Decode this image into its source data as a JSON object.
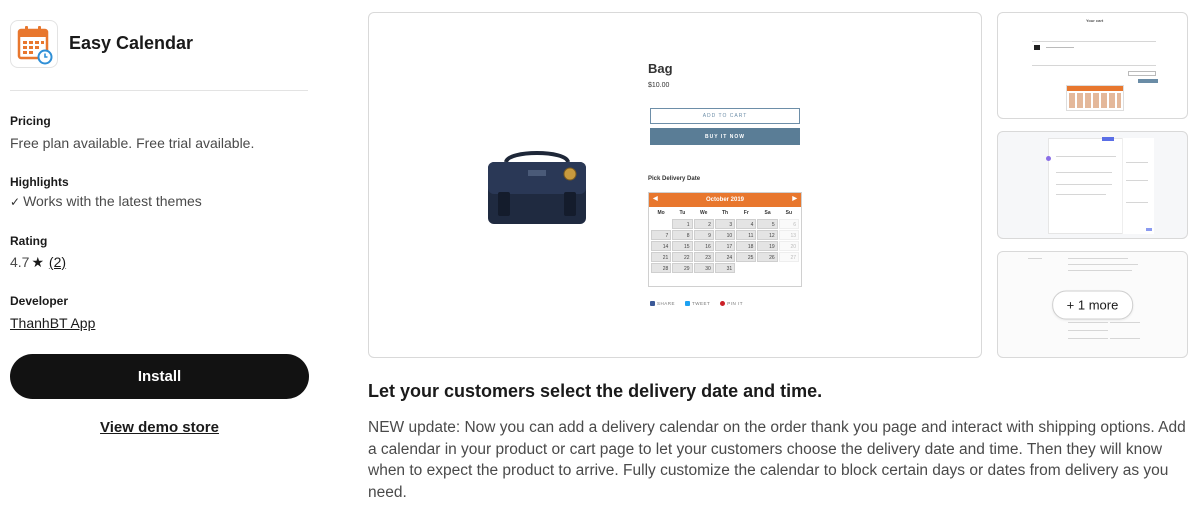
{
  "app": {
    "name": "Easy Calendar",
    "icon": "calendar-clock-icon",
    "brand_color": "#e8772e"
  },
  "details": {
    "pricing": {
      "title": "Pricing",
      "value": "Free plan available. Free trial available."
    },
    "highlights": {
      "title": "Highlights",
      "items": [
        "Works with the latest themes"
      ]
    },
    "rating": {
      "title": "Rating",
      "score": "4.7",
      "count": "(2)"
    },
    "developer": {
      "title": "Developer",
      "name": "ThanhBT App"
    }
  },
  "actions": {
    "install_label": "Install",
    "demo_label": "View demo store"
  },
  "gallery": {
    "more_label": "+ 1 more",
    "main": {
      "product_title": "Bag",
      "price": "$10.00",
      "add_to_cart": "ADD TO CART",
      "buy_now": "BUY IT NOW",
      "pick_label": "Pick Delivery Date",
      "calendar": {
        "month": "October 2019",
        "weekdays": [
          "Mo",
          "Tu",
          "We",
          "Th",
          "Fr",
          "Sa",
          "Su"
        ],
        "weeks": [
          [
            "",
            "1",
            "2",
            "3",
            "4",
            "5",
            "6"
          ],
          [
            "7",
            "8",
            "9",
            "10",
            "11",
            "12",
            "13"
          ],
          [
            "14",
            "15",
            "16",
            "17",
            "18",
            "19",
            "20"
          ],
          [
            "21",
            "22",
            "23",
            "24",
            "25",
            "26",
            "27"
          ],
          [
            "28",
            "29",
            "30",
            "31",
            "",
            "",
            ""
          ]
        ]
      },
      "share": [
        "SHARE",
        "TWEET",
        "PIN IT"
      ]
    },
    "thumb1": {
      "title": "Your cart"
    }
  },
  "content": {
    "headline": "Let your customers select the delivery date and time.",
    "description": "NEW update: Now you can add a delivery calendar on the order thank you page and interact with shipping options. Add a calendar in your product or cart page to let your customers choose the delivery date and time. Then they will know when to expect the product to arrive. Fully customize the calendar to block certain days or dates from delivery as you need."
  }
}
